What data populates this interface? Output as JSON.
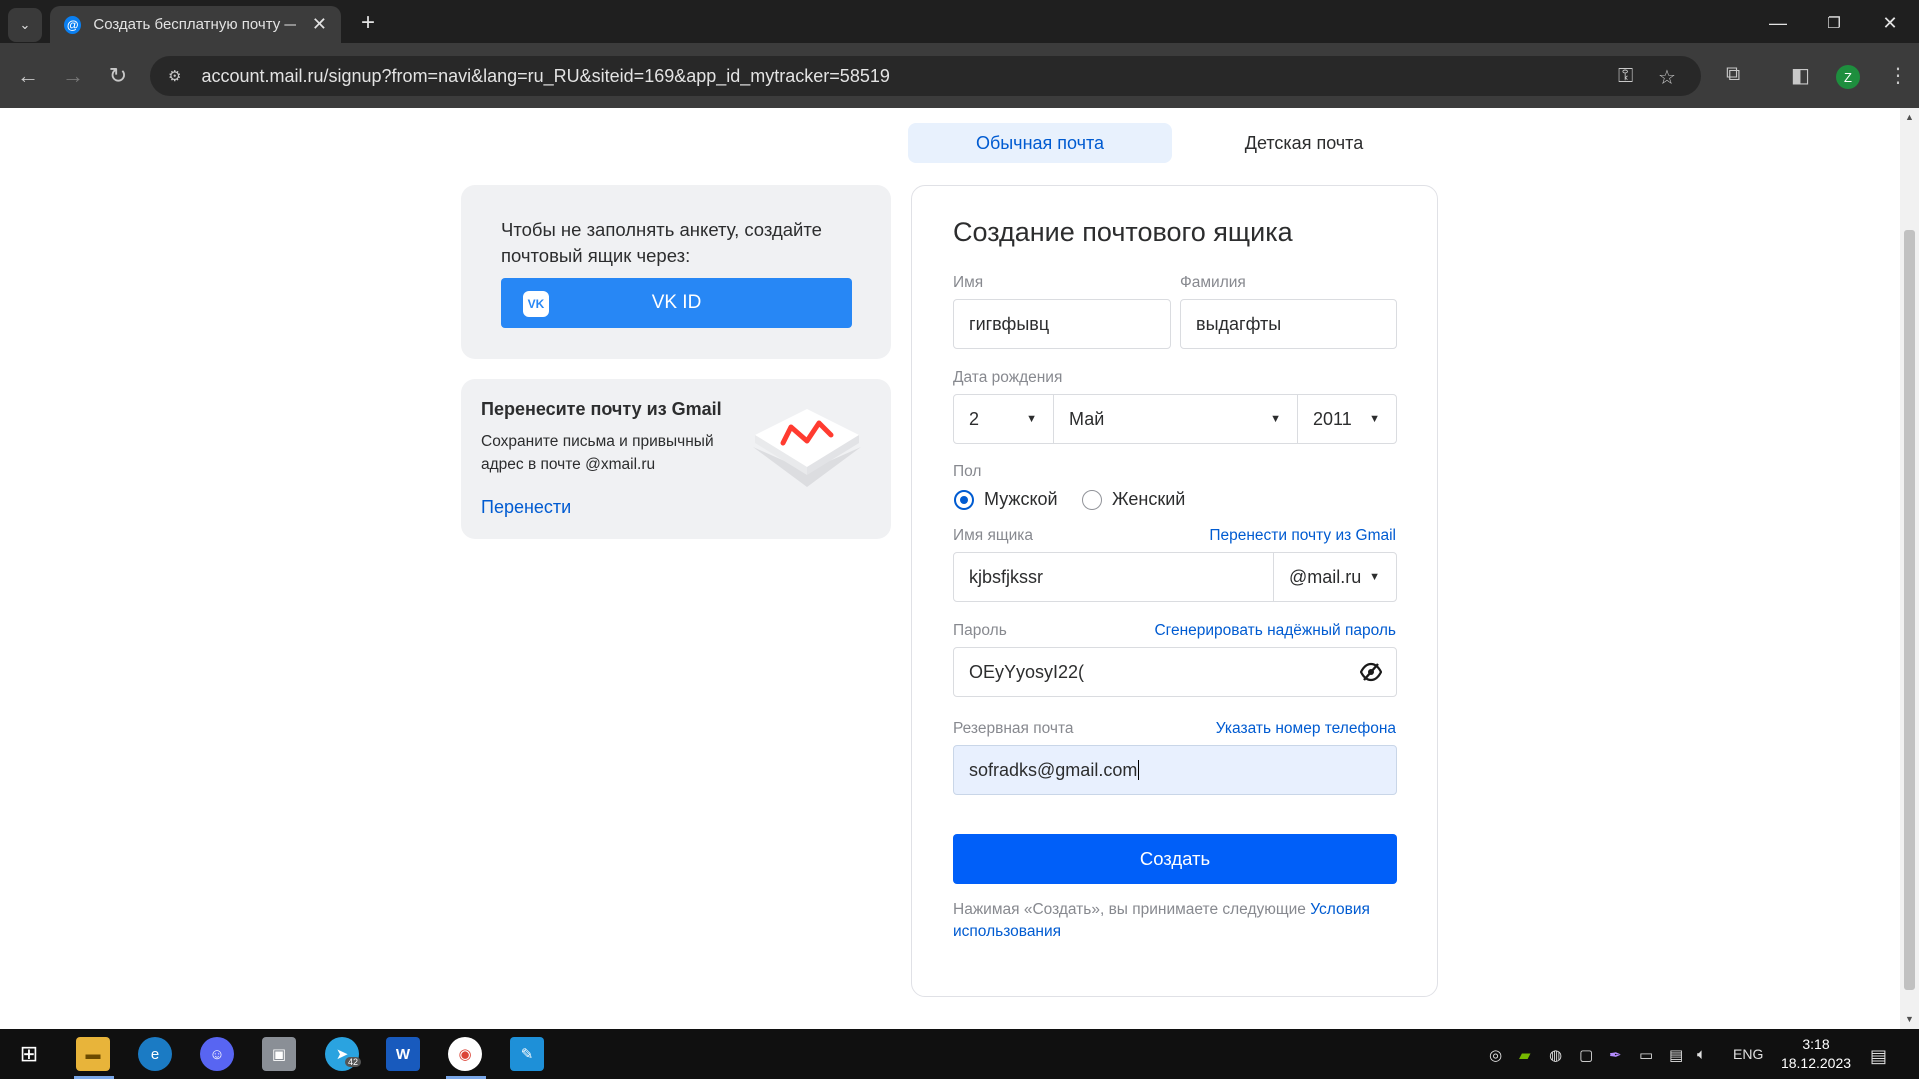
{
  "browser": {
    "tab_title": "Создать бесплатную почту —",
    "url": "account.mail.ru/signup?from=navi&lang=ru_RU&siteid=169&app_id_mytracker=58519",
    "profile_initial": "Z"
  },
  "mode_tabs": {
    "regular": "Обычная почта",
    "kids": "Детская почта"
  },
  "vk_card": {
    "text": "Чтобы не заполнять анкету, создайте почтовый ящик через:",
    "button": "VK ID"
  },
  "gmail_card": {
    "title": "Перенесите почту из Gmail",
    "description": "Сохраните письма и привычный адрес в почте @xmail.ru",
    "link": "Перенести"
  },
  "form": {
    "title": "Создание почтового ящика",
    "first_name_label": "Имя",
    "first_name_value": "гигвфывц",
    "last_name_label": "Фамилия",
    "last_name_value": "выдагфты",
    "birth_label": "Дата рождения",
    "birth_day": "2",
    "birth_month": "Май",
    "birth_year": "2011",
    "gender_label": "Пол",
    "gender_male": "Мужской",
    "gender_female": "Женский",
    "gender_selected": "male",
    "mailbox_label": "Имя ящика",
    "mailbox_link": "Перенести почту из Gmail",
    "mailbox_value": "kjbsfjkssr",
    "domain_value": "@mail.ru",
    "password_label": "Пароль",
    "password_link": "Сгенерировать надёжный пароль",
    "password_value": "OEyYyosyI22(",
    "backup_label": "Резервная почта",
    "backup_link": "Указать номер телефона",
    "backup_value": "sofradks@gmail.com",
    "submit": "Создать",
    "terms_text": "Нажимая «Создать», вы принимаете следующие ",
    "terms_link": "Условия использования"
  },
  "taskbar": {
    "lang": "ENG",
    "time": "3:18",
    "date": "18.12.2023",
    "telegram_badge": "42"
  },
  "colors": {
    "accent": "#005ff9",
    "link": "#005bd1",
    "vk": "#2787f5"
  }
}
